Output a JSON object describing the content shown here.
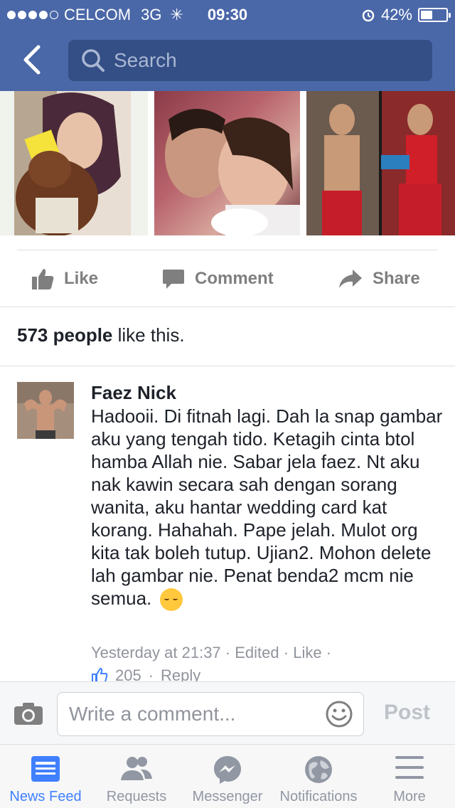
{
  "status_bar": {
    "carrier": "CELCOM",
    "network": "3G",
    "time": "09:30",
    "battery": "42%",
    "battery_level": 0.42
  },
  "header": {
    "search_placeholder": "Search"
  },
  "actions": {
    "like": "Like",
    "comment": "Comment",
    "share": "Share"
  },
  "likes": {
    "count": "573 people",
    "suffix": " like this."
  },
  "comment": {
    "author": "Faez Nick",
    "text": "Hadooii. Di fitnah lagi. Dah la snap gambar aku yang tengah tido. Ketagih cinta btol hamba Allah nie. Sabar jela faez. Nt aku nak kawin secara sah dengan sorang wanita, aku hantar wedding card kat korang. Hahahah. Pape jelah. Mulot org kita tak boleh tutup. Ujian2. Mohon delete lah gambar nie. Penat benda2 mcm nie semua.",
    "timestamp": "Yesterday at 21:37",
    "edited": "Edited",
    "like": "Like",
    "like_count": "205",
    "reply": "Reply"
  },
  "composer": {
    "placeholder": "Write a comment...",
    "post": "Post"
  },
  "tabs": [
    {
      "label": "News Feed",
      "icon": "news-feed-icon",
      "active": true
    },
    {
      "label": "Requests",
      "icon": "requests-icon",
      "active": false
    },
    {
      "label": "Messenger",
      "icon": "messenger-icon",
      "active": false
    },
    {
      "label": "Notifications",
      "icon": "notifications-icon",
      "active": false
    },
    {
      "label": "More",
      "icon": "more-icon",
      "active": false
    }
  ],
  "colors": {
    "header": "#4a67a8",
    "search_bg": "#344e86",
    "accent": "#4080ff",
    "muted": "#90949c"
  }
}
